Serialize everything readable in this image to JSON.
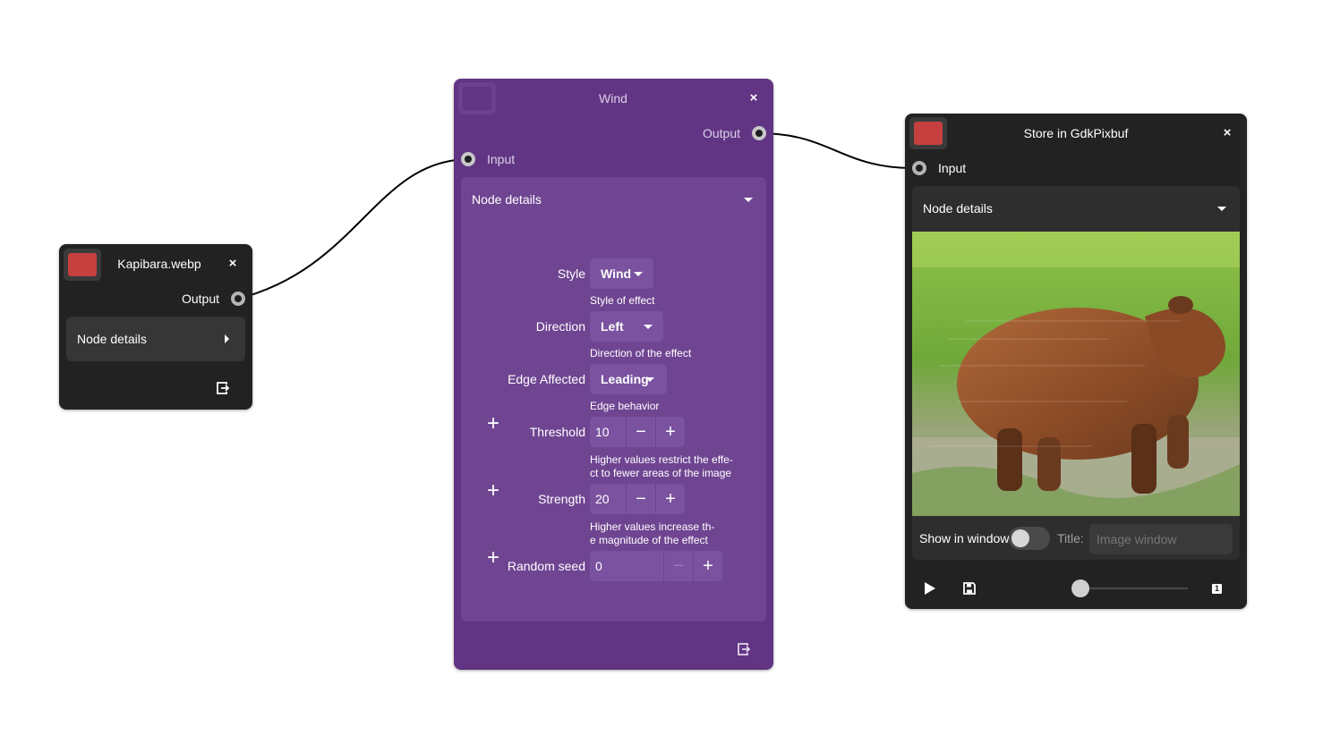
{
  "nodes": {
    "source": {
      "title": "Kapibara.webp",
      "swatch_color": "#c64040",
      "output_label": "Output",
      "details_label": "Node details",
      "close_icon": "close-icon",
      "export_icon": "export-icon"
    },
    "wind": {
      "title": "Wind",
      "input_label": "Input",
      "output_label": "Output",
      "details_label": "Node details",
      "properties": {
        "style": {
          "label": "Style",
          "value": "Wind",
          "hint": "Style of effect"
        },
        "direction": {
          "label": "Direction",
          "value": "Left",
          "hint": "Direction of the effect"
        },
        "edge": {
          "label": "Edge Affected",
          "value": "Leading",
          "hint": "Edge behavior"
        },
        "threshold": {
          "label": "Threshold",
          "value": "10",
          "hint_line1": "Higher values restrict the effe-",
          "hint_line2": "ct to fewer areas of the image"
        },
        "strength": {
          "label": "Strength",
          "value": "20",
          "hint_line1": "Higher values increase th-",
          "hint_line2": "e magnitude of the effect"
        },
        "seed": {
          "label": "Random seed",
          "value": "0"
        }
      },
      "minus": "−",
      "plus": "+",
      "add": "+"
    },
    "sink": {
      "title": "Store in GdkPixbuf",
      "swatch_color": "#c64040",
      "input_label": "Input",
      "details_label": "Node details",
      "show_in_window_label": "Show in window",
      "show_in_window_on": false,
      "title_label": "Title:",
      "title_placeholder": "Image window",
      "slider_value": 0,
      "page_badge": "1",
      "preview": "capybara-preview"
    }
  },
  "colors": {
    "canvas": "#ffffff",
    "dark_node": "#222222",
    "purple_node": "#613583",
    "wire": "#000000"
  }
}
